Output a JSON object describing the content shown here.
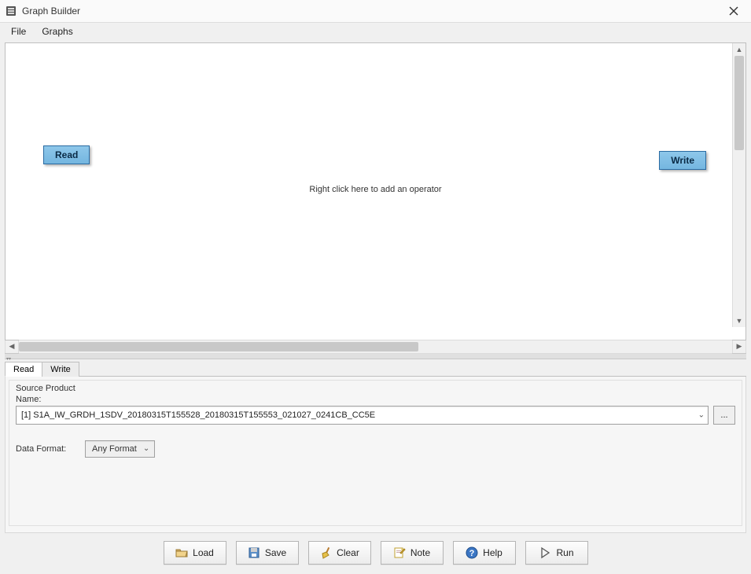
{
  "window": {
    "title": "Graph Builder"
  },
  "menu": {
    "file": "File",
    "graphs": "Graphs"
  },
  "canvas": {
    "read_node": "Read",
    "write_node": "Write",
    "hint": "Right click here to add an operator"
  },
  "tabs": {
    "read": "Read",
    "write": "Write"
  },
  "panel": {
    "section": "Source Product",
    "name_label": "Name:",
    "name_value": "[1] S1A_IW_GRDH_1SDV_20180315T155528_20180315T155553_021027_0241CB_CC5E",
    "browse": "...",
    "format_label": "Data Format:",
    "format_value": "Any Format"
  },
  "buttons": {
    "load": "Load",
    "save": "Save",
    "clear": "Clear",
    "note": "Note",
    "help": "Help",
    "run": "Run"
  }
}
